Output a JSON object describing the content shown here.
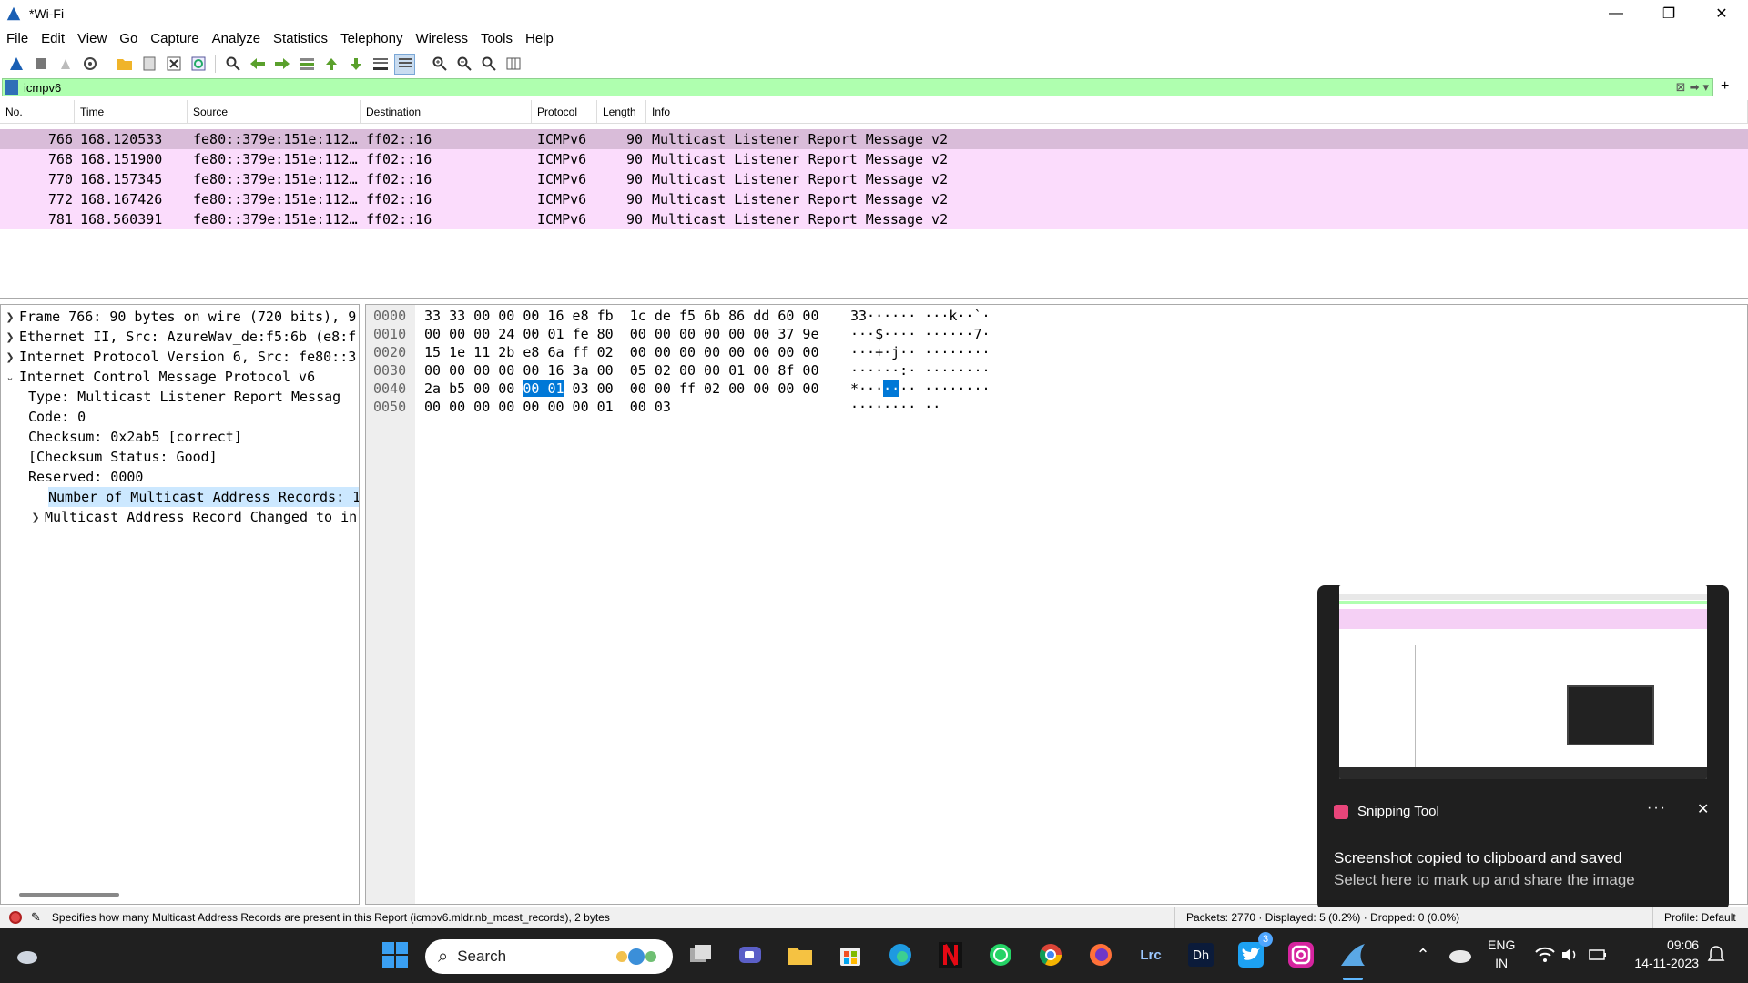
{
  "window": {
    "title": "*Wi-Fi",
    "controls": [
      "—",
      "❐",
      "✕"
    ]
  },
  "menu": [
    "File",
    "Edit",
    "View",
    "Go",
    "Capture",
    "Analyze",
    "Statistics",
    "Telephony",
    "Wireless",
    "Tools",
    "Help"
  ],
  "filter": {
    "value": "icmpv6"
  },
  "packet_list": {
    "headers": {
      "no": "No.",
      "time": "Time",
      "source": "Source",
      "destination": "Destination",
      "protocol": "Protocol",
      "length": "Length",
      "info": "Info"
    },
    "rows": [
      {
        "no": "766",
        "time": "168.120533",
        "source": "fe80::379e:151e:112…",
        "destination": "ff02::16",
        "protocol": "ICMPv6",
        "length": "90",
        "info": "Multicast Listener Report Message v2"
      },
      {
        "no": "768",
        "time": "168.151900",
        "source": "fe80::379e:151e:112…",
        "destination": "ff02::16",
        "protocol": "ICMPv6",
        "length": "90",
        "info": "Multicast Listener Report Message v2"
      },
      {
        "no": "770",
        "time": "168.157345",
        "source": "fe80::379e:151e:112…",
        "destination": "ff02::16",
        "protocol": "ICMPv6",
        "length": "90",
        "info": "Multicast Listener Report Message v2"
      },
      {
        "no": "772",
        "time": "168.167426",
        "source": "fe80::379e:151e:112…",
        "destination": "ff02::16",
        "protocol": "ICMPv6",
        "length": "90",
        "info": "Multicast Listener Report Message v2"
      },
      {
        "no": "781",
        "time": "168.560391",
        "source": "fe80::379e:151e:112…",
        "destination": "ff02::16",
        "protocol": "ICMPv6",
        "length": "90",
        "info": "Multicast Listener Report Message v2"
      }
    ]
  },
  "details": {
    "frame": "Frame 766: 90 bytes on wire (720 bits), 9",
    "ethernet": "Ethernet II, Src: AzureWav_de:f5:6b (e8:f",
    "ipv6": "Internet Protocol Version 6, Src: fe80::3",
    "icmpv6": "Internet Control Message Protocol v6",
    "type": "Type: Multicast Listener Report Messag",
    "code": "Code: 0",
    "checksum": "Checksum: 0x2ab5 [correct]",
    "checksum_status": "[Checksum Status: Good]",
    "reserved": "Reserved: 0000",
    "num_records": "Number of Multicast Address Records: 1",
    "record": "Multicast Address Record Changed to in"
  },
  "bytes": {
    "rows": [
      {
        "off": "0000",
        "hex": "33 33 00 00 00 16 e8 fb  1c de f5 6b 86 dd 60 00",
        "ascii": "33······ ···k··`·"
      },
      {
        "off": "0010",
        "hex": "00 00 00 24 00 01 fe 80  00 00 00 00 00 00 37 9e",
        "ascii": "···$···· ······7·"
      },
      {
        "off": "0020",
        "hex": "15 1e 11 2b e8 6a ff 02  00 00 00 00 00 00 00 00",
        "ascii": "···+·j·· ········"
      },
      {
        "off": "0030",
        "hex": "00 00 00 00 00 16 3a 00  05 02 00 00 01 00 8f 00",
        "ascii": "······:· ········"
      },
      {
        "off": "0050",
        "hex": "00 00 00 00 00 00 00 01  00 03",
        "ascii": "········ ··"
      }
    ],
    "hl_row": {
      "off": "0040",
      "hex_pre": "2a b5 00 00 ",
      "hex_hl": "00 01",
      "hex_post": " 03 00  00 00 ff 02 00 00 00 00",
      "ascii_pre": "*···",
      "ascii_hl": "··",
      "ascii_post": "·· ········"
    }
  },
  "toast": {
    "app": "Snipping Tool",
    "more": "···",
    "title": "Screenshot copied to clipboard and saved",
    "subtitle": "Select here to mark up and share the image"
  },
  "status": {
    "hint": "Specifies how many Multicast Address Records are present in this Report (icmpv6.mldr.nb_mcast_records), 2 bytes",
    "packets": "Packets: 2770 · Displayed: 5 (0.2%) · Dropped: 0 (0.0%)",
    "profile": "Profile: Default"
  },
  "taskbar": {
    "search": "Search",
    "lang": "ENG",
    "region": "IN",
    "time": "09:06",
    "date": "14-11-2023",
    "twitter_badge": "3",
    "lrc": "Lrc"
  }
}
